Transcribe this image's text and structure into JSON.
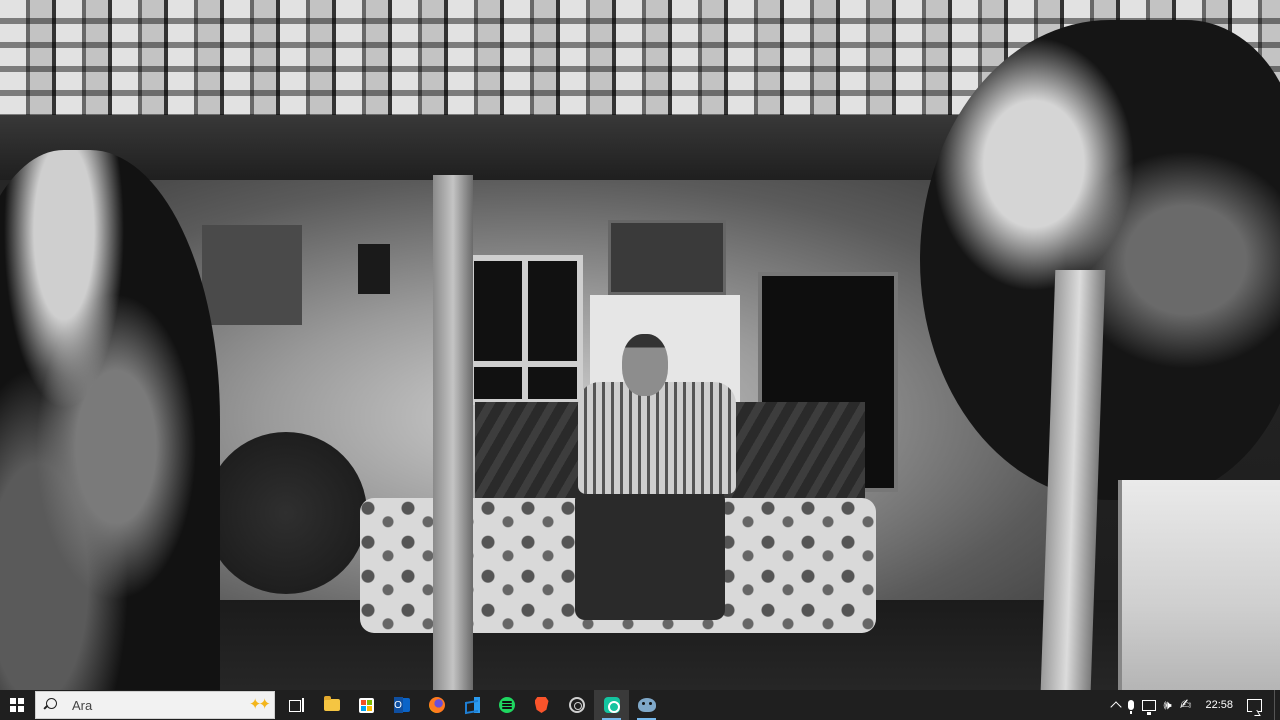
{
  "taskbar": {
    "search": {
      "placeholder": "Ara"
    },
    "apps": [
      {
        "name": "task-view",
        "icon": "task-view-icon"
      },
      {
        "name": "file-explorer",
        "icon": "folder-icon"
      },
      {
        "name": "microsoft-store",
        "icon": "store-icon"
      },
      {
        "name": "outlook",
        "icon": "outlook-icon"
      },
      {
        "name": "firefox",
        "icon": "firefox-icon"
      },
      {
        "name": "visual-studio-code",
        "icon": "vscode-icon"
      },
      {
        "name": "spotify",
        "icon": "spotify-icon"
      },
      {
        "name": "brave",
        "icon": "brave-icon"
      },
      {
        "name": "chrome",
        "icon": "chrome-icon"
      },
      {
        "name": "green-app",
        "icon": "green-app-icon",
        "active": true
      },
      {
        "name": "cat-app",
        "icon": "cat-icon",
        "running": true
      }
    ],
    "tray": {
      "time": "22:58",
      "icons": [
        "chevron-up-icon",
        "mic-icon",
        "network-icon",
        "volume-icon",
        "pen-icon",
        "notification-icon"
      ]
    }
  },
  "colors": {
    "taskbar_bg": "#1f1f1f",
    "search_bg": "#f2f2f2",
    "running_indicator": "#76b9ed"
  }
}
